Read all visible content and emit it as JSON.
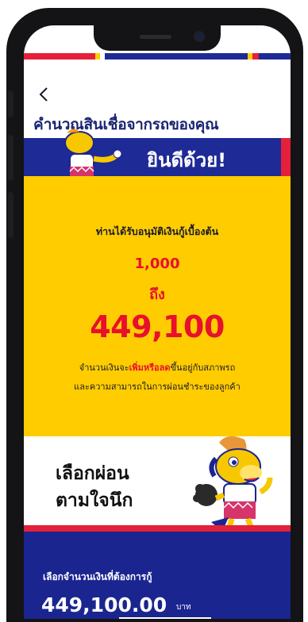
{
  "header": {
    "back_glyph": "<",
    "title": "คำนวณสินเชื่อจากรถของคุณ"
  },
  "congrats": {
    "text": "ยินดีด้วย!"
  },
  "approval": {
    "label": "ท่านได้รับอนุมัติเงินกู้เบื้องต้น",
    "min_amount": "1,000",
    "to_label": "ถึง",
    "max_amount": "449,100",
    "note_line1_prefix": "จำนวนเงินจะ",
    "note_line1_highlight": "เพิ่มหรือลด",
    "note_line1_suffix": "ขึ้นอยู่กับสภาพรถ",
    "note_line2": "และความสามารถในการผ่อนชำระของลูกค้า"
  },
  "promo": {
    "line1": "เลือกผ่อน",
    "line2": "ตามใจนึก"
  },
  "loan_input": {
    "label": "เลือกจำนวนเงินที่ต้องการกู้",
    "value": "449,100.00",
    "unit": "บาท"
  },
  "colors": {
    "brand_blue": "#1e2a96",
    "brand_yellow": "#ffcc00",
    "brand_red": "#e5203a",
    "amount_red": "#e8102d"
  },
  "icons": {
    "back": "chevron-left-icon",
    "mascot": "horse-mascot"
  }
}
